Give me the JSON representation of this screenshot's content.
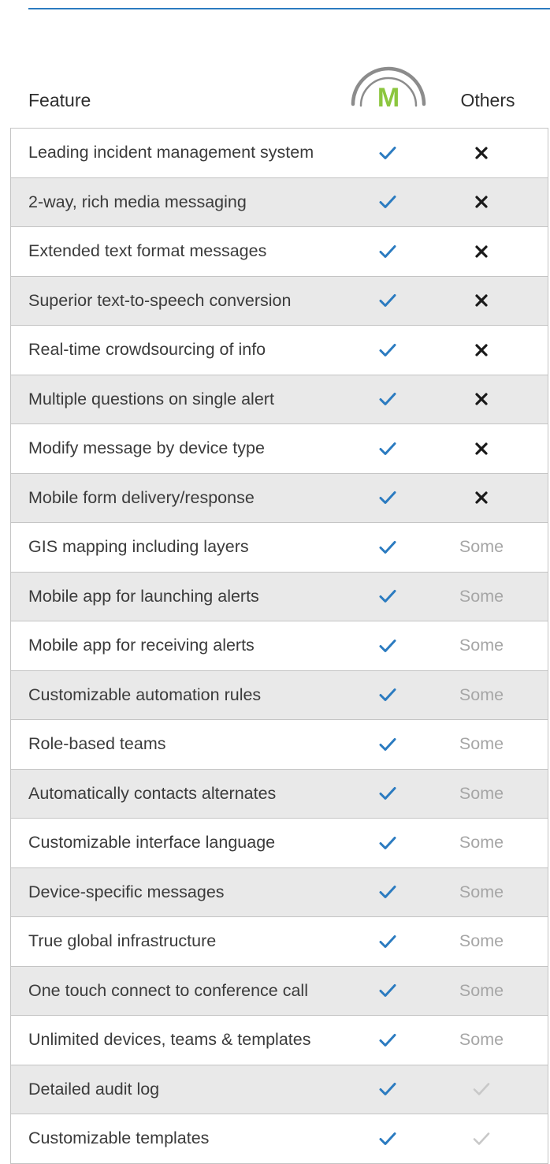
{
  "header": {
    "feature_label": "Feature",
    "brand_letter": "M",
    "others_label": "Others"
  },
  "colors": {
    "accent_blue": "#2b7bc0",
    "brand_green": "#8cc63f",
    "arc_gray": "#8c8c8c",
    "row_alt": "#e9e9e9",
    "some_text": "#a6a6a6",
    "x_mark": "#1a1a1a",
    "gray_check": "#c8c8c8"
  },
  "rows": [
    {
      "feature": "Leading incident management system",
      "m": "check-icon",
      "others": "x-icon"
    },
    {
      "feature": "2-way, rich media messaging",
      "m": "check-icon",
      "others": "x-icon"
    },
    {
      "feature": "Extended text format messages",
      "m": "check-icon",
      "others": "x-icon"
    },
    {
      "feature": "Superior text-to-speech conversion",
      "m": "check-icon",
      "others": "x-icon"
    },
    {
      "feature": "Real-time crowdsourcing of info",
      "m": "check-icon",
      "others": "x-icon"
    },
    {
      "feature": "Multiple questions on single alert",
      "m": "check-icon",
      "others": "x-icon"
    },
    {
      "feature": "Modify message by device type",
      "m": "check-icon",
      "others": "x-icon"
    },
    {
      "feature": "Mobile form delivery/response",
      "m": "check-icon",
      "others": "x-icon"
    },
    {
      "feature": "GIS mapping including layers",
      "m": "check-icon",
      "others": "Some"
    },
    {
      "feature": "Mobile app for launching alerts",
      "m": "check-icon",
      "others": "Some"
    },
    {
      "feature": "Mobile app for receiving alerts",
      "m": "check-icon",
      "others": "Some"
    },
    {
      "feature": "Customizable automation rules",
      "m": "check-icon",
      "others": "Some"
    },
    {
      "feature": "Role-based teams",
      "m": "check-icon",
      "others": "Some"
    },
    {
      "feature": "Automatically contacts alternates",
      "m": "check-icon",
      "others": "Some"
    },
    {
      "feature": "Customizable interface language",
      "m": "check-icon",
      "others": "Some"
    },
    {
      "feature": "Device-specific messages",
      "m": "check-icon",
      "others": "Some"
    },
    {
      "feature": "True global infrastructure",
      "m": "check-icon",
      "others": "Some"
    },
    {
      "feature": "One touch connect to conference call",
      "m": "check-icon",
      "others": "Some"
    },
    {
      "feature": "Unlimited devices, teams & templates",
      "m": "check-icon",
      "others": "Some"
    },
    {
      "feature": "Detailed audit log",
      "m": "check-icon",
      "others": "gray-check-icon"
    },
    {
      "feature": "Customizable templates",
      "m": "check-icon",
      "others": "gray-check-icon"
    }
  ]
}
